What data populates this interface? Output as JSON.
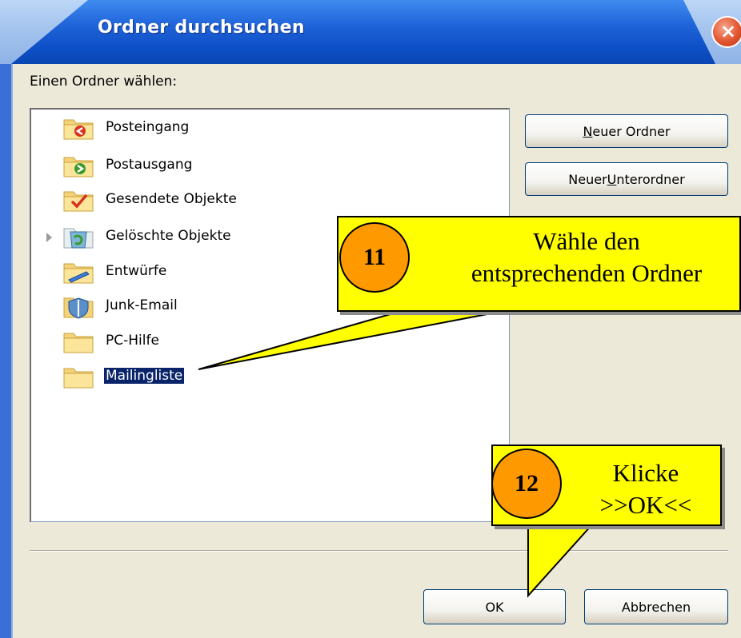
{
  "window": {
    "title": "Ordner durchsuchen",
    "close_symbol": "×"
  },
  "dialog": {
    "prompt": "Einen Ordner wählen:",
    "folders": [
      {
        "label": "Posteingang",
        "icon": "inbox-folder-icon"
      },
      {
        "label": "Postausgang",
        "icon": "outbox-folder-icon"
      },
      {
        "label": "Gesendete Objekte",
        "icon": "sent-items-folder-icon"
      },
      {
        "label": "Gelöschte Objekte",
        "icon": "deleted-items-folder-icon",
        "expandable": true
      },
      {
        "label": "Entwürfe",
        "icon": "drafts-folder-icon"
      },
      {
        "label": "Junk-Email",
        "icon": "junk-email-folder-icon"
      },
      {
        "label": "PC-Hilfe",
        "icon": "folder-icon"
      },
      {
        "label": "Mailingliste",
        "icon": "folder-icon",
        "selected": true
      }
    ],
    "buttons": {
      "new_folder": {
        "pre": "",
        "accel": "N",
        "post": "euer Ordner"
      },
      "new_subfolder": {
        "pre": "Neuer ",
        "accel": "U",
        "post": "nterordner"
      },
      "ok": "OK",
      "cancel": "Abbrechen"
    }
  },
  "callouts": [
    {
      "step": "11",
      "line1": "Wähle den",
      "line2": "entsprechenden Ordner"
    },
    {
      "step": "12",
      "line1": "Klicke",
      "line2": ">>OK<<"
    }
  ],
  "colors": {
    "titlebar": "#1f63d9",
    "dialog_bg": "#ece9d8",
    "selection": "#0a246a",
    "callout": "#ffff00",
    "step_circle": "#ff9900"
  }
}
